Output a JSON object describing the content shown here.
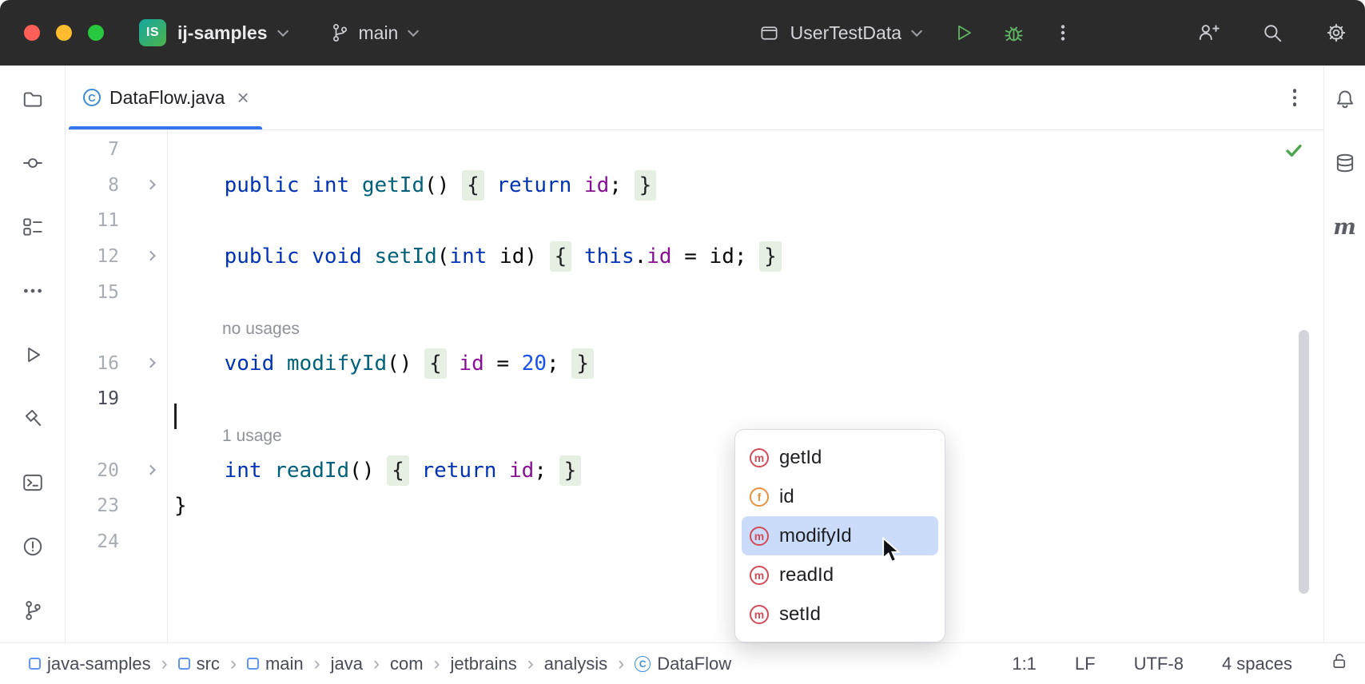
{
  "icons": {
    "class_letter": "C",
    "method_letter": "m",
    "field_letter": "f"
  },
  "colors": {
    "accent_blue": "#3574f0",
    "run_green": "#5fb363",
    "keyword": "#0033b3",
    "method": "#00627a",
    "field": "#871094",
    "number": "#1750eb",
    "folded_region_bg": "#e5f0e3",
    "selected_item_bg": "#cbdcfb"
  },
  "titlebar": {
    "project_badge": "IS",
    "project_name": "ij-samples",
    "branch_name": "main",
    "run_config_name": "UserTestData"
  },
  "rails": {
    "left": [
      "project",
      "commit",
      "structure",
      "more",
      "run",
      "build",
      "terminal",
      "problems",
      "version-control"
    ],
    "right": [
      "notifications",
      "database",
      "maven"
    ]
  },
  "tabbar": {
    "tabs": [
      {
        "label": "DataFlow.java",
        "icon": "class",
        "active": true
      }
    ]
  },
  "editor": {
    "inspection_status": "passed",
    "rows": [
      {
        "type": "code",
        "num": "7",
        "tokens": []
      },
      {
        "type": "code",
        "num": "8",
        "fold": true,
        "tokens": [
          {
            "t": "    "
          },
          {
            "t": "public",
            "c": "kw"
          },
          {
            "t": " "
          },
          {
            "t": "int",
            "c": "kw"
          },
          {
            "t": " "
          },
          {
            "t": "getId",
            "c": "mth"
          },
          {
            "t": "() "
          },
          {
            "t": "{",
            "c": "fold"
          },
          {
            "t": " "
          },
          {
            "t": "return",
            "c": "kw"
          },
          {
            "t": " "
          },
          {
            "t": "id",
            "c": "fld"
          },
          {
            "t": "; "
          },
          {
            "t": "}",
            "c": "fold"
          }
        ]
      },
      {
        "type": "code",
        "num": "11",
        "tokens": []
      },
      {
        "type": "code",
        "num": "12",
        "fold": true,
        "tokens": [
          {
            "t": "    "
          },
          {
            "t": "public",
            "c": "kw"
          },
          {
            "t": " "
          },
          {
            "t": "void",
            "c": "kw"
          },
          {
            "t": " "
          },
          {
            "t": "setId",
            "c": "mth"
          },
          {
            "t": "("
          },
          {
            "t": "int",
            "c": "kw"
          },
          {
            "t": " id) "
          },
          {
            "t": "{",
            "c": "fold"
          },
          {
            "t": " "
          },
          {
            "t": "this",
            "c": "kw"
          },
          {
            "t": "."
          },
          {
            "t": "id",
            "c": "fld"
          },
          {
            "t": " = id; "
          },
          {
            "t": "}",
            "c": "fold"
          }
        ]
      },
      {
        "type": "code",
        "num": "15",
        "tokens": []
      },
      {
        "type": "inlay",
        "text": "no usages"
      },
      {
        "type": "code",
        "num": "16",
        "fold": true,
        "tokens": [
          {
            "t": "    "
          },
          {
            "t": "void",
            "c": "kw"
          },
          {
            "t": " "
          },
          {
            "t": "modifyId",
            "c": "mth"
          },
          {
            "t": "() "
          },
          {
            "t": "{",
            "c": "fold"
          },
          {
            "t": " "
          },
          {
            "t": "id",
            "c": "fld"
          },
          {
            "t": " = "
          },
          {
            "t": "20",
            "c": "num"
          },
          {
            "t": "; "
          },
          {
            "t": "}",
            "c": "fold"
          }
        ]
      },
      {
        "type": "code",
        "num": "19",
        "caret": true,
        "current": true,
        "tokens": []
      },
      {
        "type": "inlay",
        "text": "1 usage"
      },
      {
        "type": "code",
        "num": "20",
        "fold": true,
        "tokens": [
          {
            "t": "    "
          },
          {
            "t": "int",
            "c": "kw"
          },
          {
            "t": " "
          },
          {
            "t": "readId",
            "c": "mth"
          },
          {
            "t": "() "
          },
          {
            "t": "{",
            "c": "fold"
          },
          {
            "t": " "
          },
          {
            "t": "return",
            "c": "kw"
          },
          {
            "t": " "
          },
          {
            "t": "id",
            "c": "fld"
          },
          {
            "t": "; "
          },
          {
            "t": "}",
            "c": "fold"
          }
        ]
      },
      {
        "type": "code",
        "num": "23",
        "tokens": [
          {
            "t": "}"
          }
        ]
      },
      {
        "type": "code",
        "num": "24",
        "tokens": []
      }
    ]
  },
  "popup": {
    "items": [
      {
        "icon": "m",
        "label": "getId"
      },
      {
        "icon": "f",
        "label": "id"
      },
      {
        "icon": "m",
        "label": "modifyId",
        "selected": true
      },
      {
        "icon": "m",
        "label": "readId"
      },
      {
        "icon": "m",
        "label": "setId"
      }
    ]
  },
  "statusbar": {
    "breadcrumbs": [
      {
        "label": "java-samples",
        "icon": "module"
      },
      {
        "label": "src",
        "icon": "module"
      },
      {
        "label": "main",
        "icon": "module"
      },
      {
        "label": "java"
      },
      {
        "label": "com"
      },
      {
        "label": "jetbrains"
      },
      {
        "label": "analysis"
      },
      {
        "label": "DataFlow",
        "icon": "class"
      }
    ],
    "caret_position": "1:1",
    "line_separator": "LF",
    "encoding": "UTF-8",
    "indent": "4 spaces"
  }
}
